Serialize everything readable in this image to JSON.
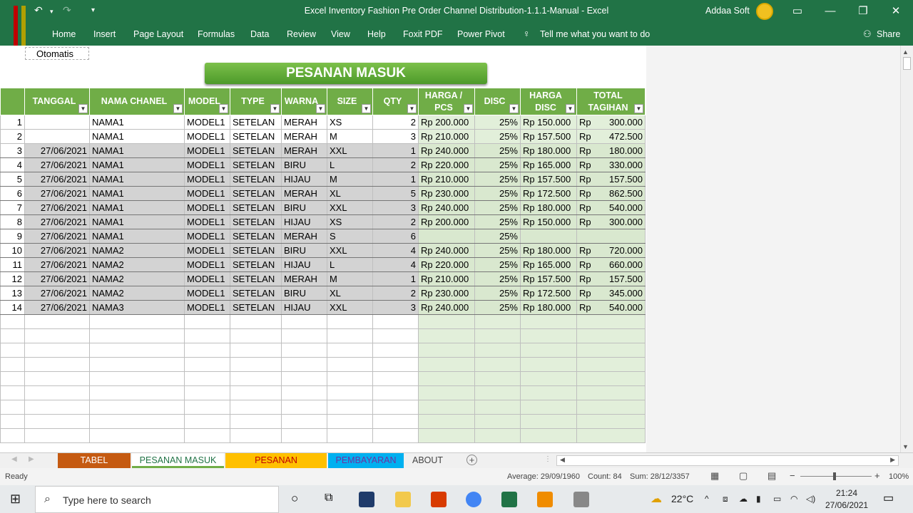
{
  "window": {
    "title": "Excel Inventory Fashion Pre Order Channel Distribution-1.1.1-Manual  -  Excel",
    "user": "Addaa Soft"
  },
  "ribbon": {
    "tabs": [
      "Home",
      "Insert",
      "Page Layout",
      "Formulas",
      "Data",
      "Review",
      "View",
      "Help",
      "Foxit PDF",
      "Power Pivot"
    ],
    "tell_me": "Tell me what you want to do",
    "share": "Share"
  },
  "sheet": {
    "otomatis": "Otomatis",
    "banner": "PESANAN MASUK",
    "headers": [
      "TANGGAL",
      "NAMA CHANEL",
      "MODEL",
      "TYPE",
      "WARNA",
      "SIZE",
      "QTY",
      "HARGA / PCS",
      "DISC",
      "HARGA DISC",
      "TOTAL TAGIHAN"
    ],
    "rows": [
      [
        "1",
        "",
        "NAMA1",
        "MODEL1",
        "SETELAN",
        "MERAH",
        "XS",
        "2",
        "Rp 200.000",
        "25%",
        "Rp 150.000",
        "Rp",
        "300.000"
      ],
      [
        "2",
        "",
        "NAMA1",
        "MODEL1",
        "SETELAN",
        "MERAH",
        "M",
        "3",
        "Rp 210.000",
        "25%",
        "Rp 157.500",
        "Rp",
        "472.500"
      ],
      [
        "3",
        "27/06/2021",
        "NAMA1",
        "MODEL1",
        "SETELAN",
        "MERAH",
        "XXL",
        "1",
        "Rp 240.000",
        "25%",
        "Rp 180.000",
        "Rp",
        "180.000"
      ],
      [
        "4",
        "27/06/2021",
        "NAMA1",
        "MODEL1",
        "SETELAN",
        "BIRU",
        "L",
        "2",
        "Rp 220.000",
        "25%",
        "Rp 165.000",
        "Rp",
        "330.000"
      ],
      [
        "5",
        "27/06/2021",
        "NAMA1",
        "MODEL1",
        "SETELAN",
        "HIJAU",
        "M",
        "1",
        "Rp 210.000",
        "25%",
        "Rp 157.500",
        "Rp",
        "157.500"
      ],
      [
        "6",
        "27/06/2021",
        "NAMA1",
        "MODEL1",
        "SETELAN",
        "MERAH",
        "XL",
        "5",
        "Rp 230.000",
        "25%",
        "Rp 172.500",
        "Rp",
        "862.500"
      ],
      [
        "7",
        "27/06/2021",
        "NAMA1",
        "MODEL1",
        "SETELAN",
        "BIRU",
        "XXL",
        "3",
        "Rp 240.000",
        "25%",
        "Rp 180.000",
        "Rp",
        "540.000"
      ],
      [
        "8",
        "27/06/2021",
        "NAMA1",
        "MODEL1",
        "SETELAN",
        "HIJAU",
        "XS",
        "2",
        "Rp 200.000",
        "25%",
        "Rp 150.000",
        "Rp",
        "300.000"
      ],
      [
        "9",
        "27/06/2021",
        "NAMA1",
        "MODEL1",
        "SETELAN",
        "MERAH",
        "S",
        "6",
        "",
        "25%",
        "",
        "",
        ""
      ],
      [
        "10",
        "27/06/2021",
        "NAMA2",
        "MODEL1",
        "SETELAN",
        "BIRU",
        "XXL",
        "4",
        "Rp 240.000",
        "25%",
        "Rp 180.000",
        "Rp",
        "720.000"
      ],
      [
        "11",
        "27/06/2021",
        "NAMA2",
        "MODEL1",
        "SETELAN",
        "HIJAU",
        "L",
        "4",
        "Rp 220.000",
        "25%",
        "Rp 165.000",
        "Rp",
        "660.000"
      ],
      [
        "12",
        "27/06/2021",
        "NAMA2",
        "MODEL1",
        "SETELAN",
        "MERAH",
        "M",
        "1",
        "Rp 210.000",
        "25%",
        "Rp 157.500",
        "Rp",
        "157.500"
      ],
      [
        "13",
        "27/06/2021",
        "NAMA2",
        "MODEL1",
        "SETELAN",
        "BIRU",
        "XL",
        "2",
        "Rp 230.000",
        "25%",
        "Rp 172.500",
        "Rp",
        "345.000"
      ],
      [
        "14",
        "27/06/2021",
        "NAMA3",
        "MODEL1",
        "SETELAN",
        "HIJAU",
        "XXL",
        "3",
        "Rp 240.000",
        "25%",
        "Rp 180.000",
        "Rp",
        "540.000"
      ]
    ]
  },
  "sheet_tabs": [
    {
      "label": "TABEL BANTU",
      "color": "#c55a11"
    },
    {
      "label": "PESANAN MASUK",
      "color": "#70ad47"
    },
    {
      "label": "PESANAN TERKIRIM",
      "color": "#ffc000"
    },
    {
      "label": "PEMBAYARAN",
      "color": "#00b0f0"
    },
    {
      "label": "ABOUT",
      "color": "#f0f0f0"
    }
  ],
  "status": {
    "ready": "Ready",
    "average": "Average: 29/09/1960",
    "count": "Count: 84",
    "sum": "Sum: 28/12/3357",
    "zoom": "100%"
  },
  "taskbar": {
    "search": "Type here to search",
    "temp": "22°C",
    "time": "21:24",
    "date": "27/06/2021"
  },
  "colors": {
    "excel_green": "#217346",
    "header_green": "#70ad47"
  }
}
